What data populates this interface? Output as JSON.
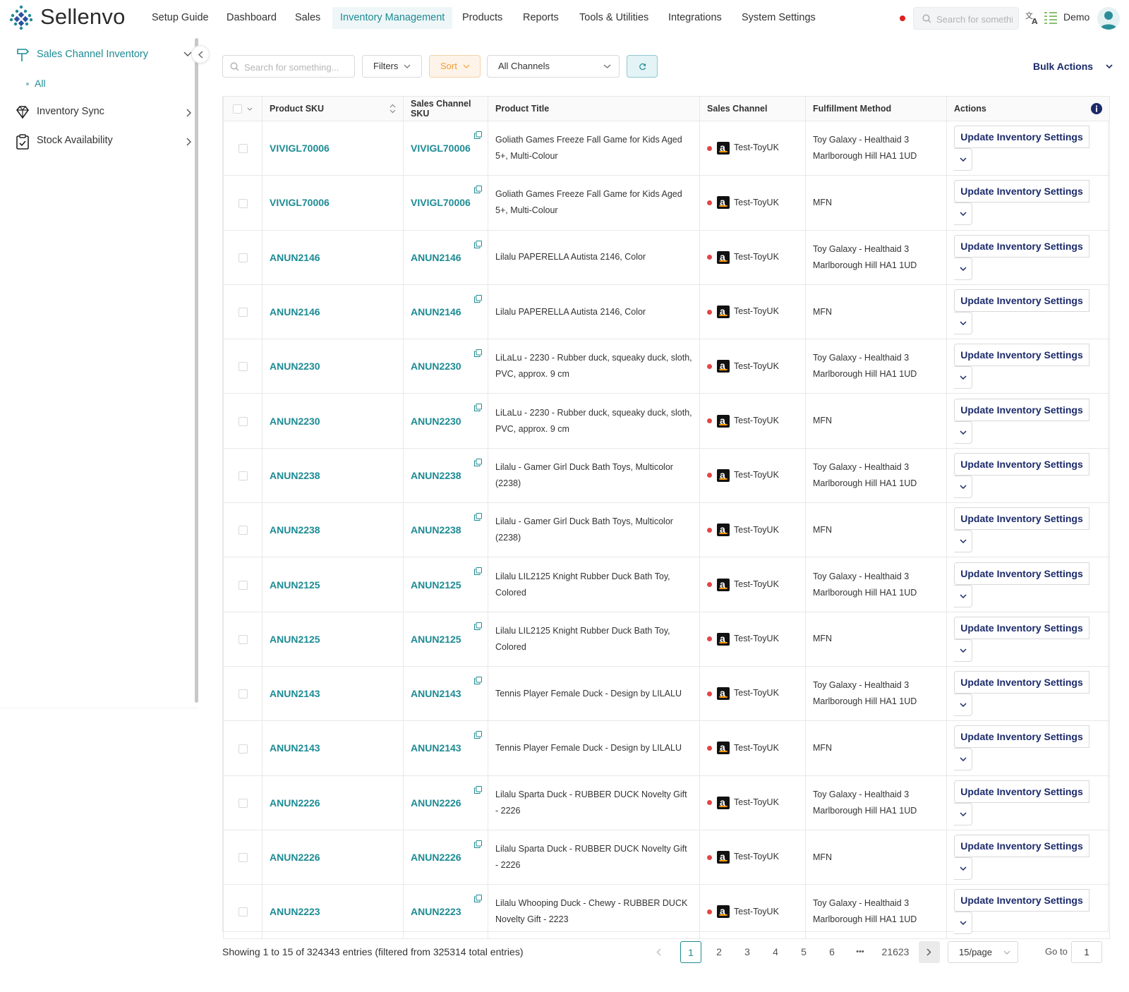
{
  "app": {
    "name": "Sellenvo"
  },
  "nav": {
    "items": [
      "Setup Guide",
      "Dashboard",
      "Sales",
      "Inventory Management",
      "Products",
      "Reports",
      "Tools & Utilities",
      "Integrations",
      "System Settings"
    ],
    "active": "Inventory Management"
  },
  "header": {
    "search_placeholder": "Search for something...",
    "user_name": "Demo"
  },
  "sidebar": {
    "items": [
      {
        "label": "Sales Channel Inventory",
        "icon": "signpost-icon",
        "expanded": true
      },
      {
        "label": "Inventory Sync",
        "icon": "gem-icon",
        "expanded": false
      },
      {
        "label": "Stock Availability",
        "icon": "clipboard-check-icon",
        "expanded": false
      }
    ],
    "sub_item": "All"
  },
  "toolbar": {
    "search_placeholder": "Search for something...",
    "filters_label": "Filters",
    "sort_label": "Sort",
    "channel_select": "All Channels",
    "bulk_actions_label": "Bulk Actions"
  },
  "table": {
    "columns": [
      "",
      "Product SKU",
      "Sales Channel SKU",
      "Product Title",
      "Sales Channel",
      "Fulfillment Method",
      "Actions"
    ],
    "action_label": "Update Inventory Settings",
    "rows": [
      {
        "sku": "VIVIGL70006",
        "channel_sku": "VIVIGL70006",
        "title": "Goliath Games Freeze Fall Game for Kids Aged 5+, Multi-Colour",
        "channel": "Test-ToyUK",
        "fulfillment": "Toy Galaxy - Healthaid 3 Marlborough Hill HA1 1UD"
      },
      {
        "sku": "VIVIGL70006",
        "channel_sku": "VIVIGL70006",
        "title": "Goliath Games Freeze Fall Game for Kids Aged 5+, Multi-Colour",
        "channel": "Test-ToyUK",
        "fulfillment": "MFN"
      },
      {
        "sku": "ANUN2146",
        "channel_sku": "ANUN2146",
        "title": "Lilalu PAPERELLA Autista 2146, Color",
        "channel": "Test-ToyUK",
        "fulfillment": "Toy Galaxy - Healthaid 3 Marlborough Hill HA1 1UD"
      },
      {
        "sku": "ANUN2146",
        "channel_sku": "ANUN2146",
        "title": "Lilalu PAPERELLA Autista 2146, Color",
        "channel": "Test-ToyUK",
        "fulfillment": "MFN"
      },
      {
        "sku": "ANUN2230",
        "channel_sku": "ANUN2230",
        "title": "LiLaLu - 2230 - Rubber duck, squeaky duck, sloth, PVC, approx. 9 cm",
        "channel": "Test-ToyUK",
        "fulfillment": "Toy Galaxy - Healthaid 3 Marlborough Hill HA1 1UD"
      },
      {
        "sku": "ANUN2230",
        "channel_sku": "ANUN2230",
        "title": "LiLaLu - 2230 - Rubber duck, squeaky duck, sloth, PVC, approx. 9 cm",
        "channel": "Test-ToyUK",
        "fulfillment": "MFN"
      },
      {
        "sku": "ANUN2238",
        "channel_sku": "ANUN2238",
        "title": "Lilalu - Gamer Girl Duck Bath Toys, Multicolor (2238)",
        "channel": "Test-ToyUK",
        "fulfillment": "Toy Galaxy - Healthaid 3 Marlborough Hill HA1 1UD"
      },
      {
        "sku": "ANUN2238",
        "channel_sku": "ANUN2238",
        "title": "Lilalu - Gamer Girl Duck Bath Toys, Multicolor (2238)",
        "channel": "Test-ToyUK",
        "fulfillment": "MFN"
      },
      {
        "sku": "ANUN2125",
        "channel_sku": "ANUN2125",
        "title": "Lilalu LIL2125 Knight Rubber Duck Bath Toy, Colored",
        "channel": "Test-ToyUK",
        "fulfillment": "Toy Galaxy - Healthaid 3 Marlborough Hill HA1 1UD"
      },
      {
        "sku": "ANUN2125",
        "channel_sku": "ANUN2125",
        "title": "Lilalu LIL2125 Knight Rubber Duck Bath Toy, Colored",
        "channel": "Test-ToyUK",
        "fulfillment": "MFN"
      },
      {
        "sku": "ANUN2143",
        "channel_sku": "ANUN2143",
        "title": "Tennis Player Female Duck - Design by LILALU",
        "channel": "Test-ToyUK",
        "fulfillment": "Toy Galaxy - Healthaid 3 Marlborough Hill HA1 1UD"
      },
      {
        "sku": "ANUN2143",
        "channel_sku": "ANUN2143",
        "title": "Tennis Player Female Duck - Design by LILALU",
        "channel": "Test-ToyUK",
        "fulfillment": "MFN"
      },
      {
        "sku": "ANUN2226",
        "channel_sku": "ANUN2226",
        "title": "Lilalu Sparta Duck - RUBBER DUCK Novelty Gift - 2226",
        "channel": "Test-ToyUK",
        "fulfillment": "Toy Galaxy - Healthaid 3 Marlborough Hill HA1 1UD"
      },
      {
        "sku": "ANUN2226",
        "channel_sku": "ANUN2226",
        "title": "Lilalu Sparta Duck - RUBBER DUCK Novelty Gift - 2226",
        "channel": "Test-ToyUK",
        "fulfillment": "MFN"
      },
      {
        "sku": "ANUN2223",
        "channel_sku": "ANUN2223",
        "title": "Lilalu Whooping Duck - Chewy - RUBBER DUCK Novelty Gift - 2223",
        "channel": "Test-ToyUK",
        "fulfillment": "Toy Galaxy - Healthaid 3 Marlborough Hill HA1 1UD"
      }
    ]
  },
  "footer": {
    "showing_text": "Showing 1 to 15 of 324343 entries (filtered from 325314 total entries)",
    "pages": [
      "1",
      "2",
      "3",
      "4",
      "5",
      "6"
    ],
    "ellipsis": "•••",
    "last_page": "21623",
    "current_page": "1",
    "per_page": "15/page",
    "goto_label": "Go to",
    "goto_value": "1"
  },
  "colors": {
    "accent": "#1d8b94",
    "action_text": "#1b2a6b",
    "sort_orange": "#f39c38",
    "status_red": "#e54545"
  }
}
